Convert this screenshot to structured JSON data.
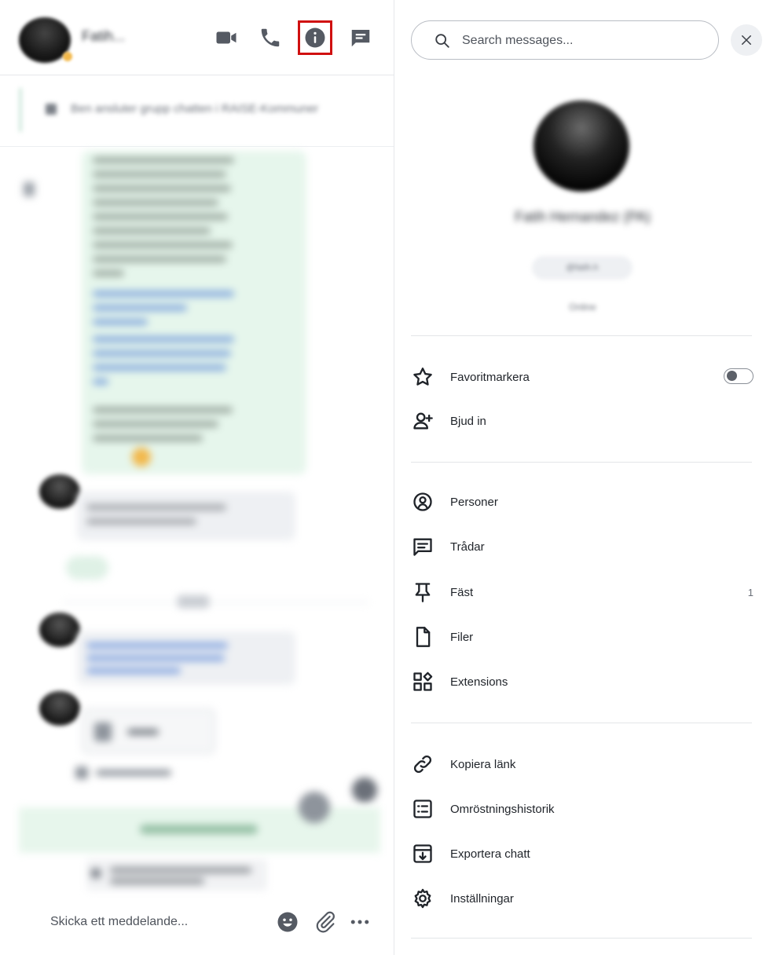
{
  "chat": {
    "header": {
      "contact_name": "Fatih...",
      "buttons": [
        {
          "name": "video-call-button",
          "icon": "video-camera-icon"
        },
        {
          "name": "voice-call-button",
          "icon": "phone-icon"
        },
        {
          "name": "info-button",
          "icon": "info-icon",
          "active": true
        },
        {
          "name": "threads-button",
          "icon": "chat-bubble-icon"
        }
      ]
    },
    "pinned_text": "Ben ansluter grupp chatten i RAISE-Kommuner",
    "composer": {
      "placeholder": "Skicka ett meddelande...",
      "buttons": [
        "emoji-icon",
        "paperclip-icon",
        "more-icon"
      ]
    }
  },
  "info_panel": {
    "search": {
      "placeholder": "Search messages..."
    },
    "profile": {
      "name": "Fatih Hernandez (PA)",
      "tag": "@fatih.h",
      "status": "Online"
    },
    "section1": [
      {
        "label": "Favoritmarkera",
        "icon": "star-icon",
        "toggle": false
      },
      {
        "label": "Bjud in",
        "icon": "add-user-icon"
      }
    ],
    "section2": [
      {
        "label": "Personer",
        "icon": "person-circle-icon"
      },
      {
        "label": "Trådar",
        "icon": "threads-icon"
      },
      {
        "label": "Fäst",
        "icon": "pin-icon",
        "count": "1"
      },
      {
        "label": "Filer",
        "icon": "file-icon"
      },
      {
        "label": "Extensions",
        "icon": "extensions-icon"
      }
    ],
    "section3": [
      {
        "label": "Kopiera länk",
        "icon": "link-icon"
      },
      {
        "label": "Omröstningshistorik",
        "icon": "poll-icon"
      },
      {
        "label": "Exportera chatt",
        "icon": "export-icon"
      },
      {
        "label": "Inställningar",
        "icon": "gear-icon"
      }
    ]
  },
  "colors": {
    "accent_highlight": "#d01010",
    "icon_grey": "#555a63",
    "message_green": "#e6f6ec"
  }
}
